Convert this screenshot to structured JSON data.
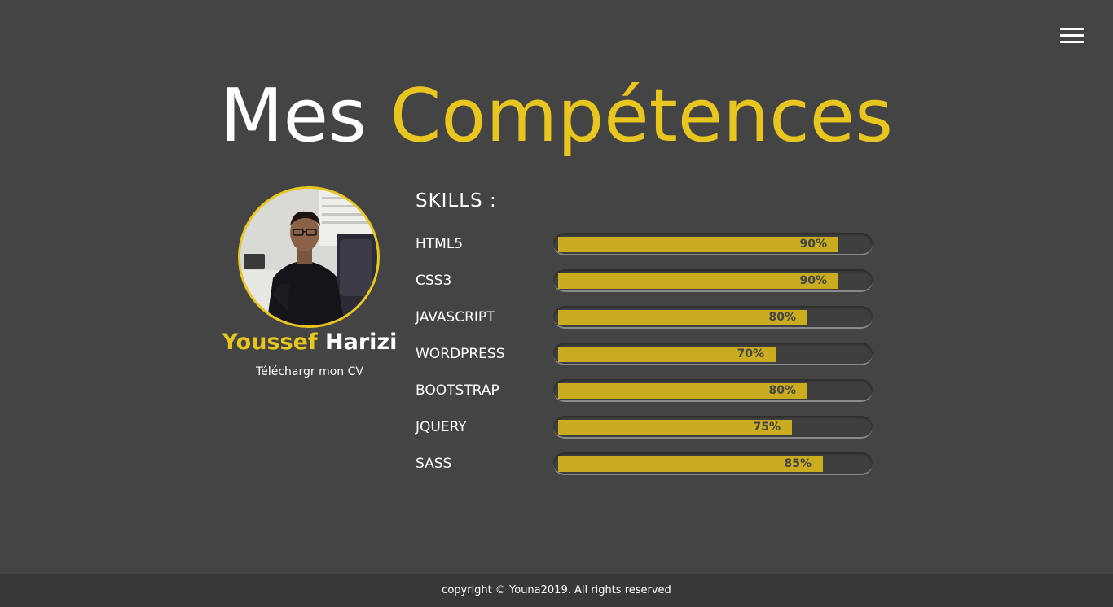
{
  "header": {
    "menu_icon": "hamburger-menu-icon"
  },
  "title": {
    "part1": "Mes",
    "part2": "Compétences",
    "accent_color": "#e8c51f"
  },
  "profile": {
    "photo": "profile-photo",
    "first_name": "Youssef",
    "last_name": "Harizi",
    "cv_link": "Téléchargr mon CV"
  },
  "skills": {
    "heading": "SKILLS :",
    "items": [
      {
        "label": "HTML5",
        "percent": 90,
        "percent_text": "90%"
      },
      {
        "label": "CSS3",
        "percent": 90,
        "percent_text": "90%"
      },
      {
        "label": "JAVASCRIPT",
        "percent": 80,
        "percent_text": "80%"
      },
      {
        "label": "WORDPRESS",
        "percent": 70,
        "percent_text": "70%"
      },
      {
        "label": "BOOTSTRAP",
        "percent": 80,
        "percent_text": "80%"
      },
      {
        "label": "JQUERY",
        "percent": 75,
        "percent_text": "75%"
      },
      {
        "label": "SASS",
        "percent": 85,
        "percent_text": "85%"
      }
    ],
    "fill_color": "#c9ac1f"
  },
  "footer": {
    "text": "copyright © Youna2019. All rights reserved"
  }
}
